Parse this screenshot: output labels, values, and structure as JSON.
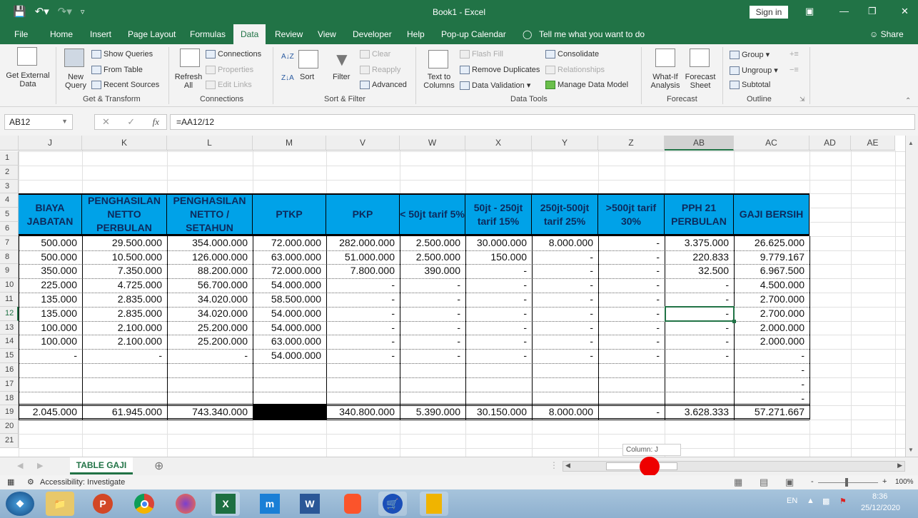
{
  "app": {
    "title": "Book1  -  Excel",
    "sign_in": "Sign in",
    "share": "Share"
  },
  "menu": {
    "tabs": [
      "File",
      "Home",
      "Insert",
      "Page Layout",
      "Formulas",
      "Data",
      "Review",
      "View",
      "Developer",
      "Help",
      "Pop-up Calendar"
    ],
    "active_tab": "Data",
    "tell_me": "Tell me what you want to do"
  },
  "ribbon": {
    "get_external_data": "Get External Data",
    "new_query": "New Query",
    "show_queries": "Show Queries",
    "from_table": "From Table",
    "recent_sources": "Recent Sources",
    "get_transform": "Get & Transform",
    "refresh_all": "Refresh All",
    "connections": "Connections",
    "properties": "Properties",
    "edit_links": "Edit Links",
    "connections_group": "Connections",
    "sort": "Sort",
    "filter": "Filter",
    "clear": "Clear",
    "reapply": "Reapply",
    "advanced": "Advanced",
    "sort_filter_group": "Sort & Filter",
    "text_to_columns": "Text to Columns",
    "flash_fill": "Flash Fill",
    "remove_duplicates": "Remove Duplicates",
    "data_validation": "Data Validation",
    "consolidate": "Consolidate",
    "relationships": "Relationships",
    "manage_data_model": "Manage Data Model",
    "data_tools_group": "Data Tools",
    "what_if": "What-If Analysis",
    "forecast_sheet": "Forecast Sheet",
    "forecast_group": "Forecast",
    "group": "Group",
    "ungroup": "Ungroup",
    "subtotal": "Subtotal",
    "outline_group": "Outline"
  },
  "formula_bar": {
    "name_box": "AB12",
    "formula": "=AA12/12",
    "fx": "fx"
  },
  "columns": [
    "J",
    "K",
    "L",
    "M",
    "V",
    "W",
    "X",
    "Y",
    "Z",
    "AB",
    "AC",
    "AD",
    "AE"
  ],
  "selected_column": "AB",
  "rows": [
    "1",
    "2",
    "3",
    "4",
    "5",
    "6",
    "7",
    "8",
    "9",
    "10",
    "11",
    "12",
    "13",
    "14",
    "15",
    "16",
    "17",
    "18",
    "19",
    "20",
    "21"
  ],
  "selected_row": "12",
  "table": {
    "headers": [
      "BIAYA JABATAN",
      "PENGHASILAN NETTO PERBULAN",
      "PENGHASILAN NETTO / SETAHUN",
      "PTKP",
      "PKP",
      "< 50jt tarif 5%",
      "50jt - 250jt tarif 15%",
      "250jt-500jt tarif 25%",
      ">500jt tarif 30%",
      "PPH 21 PERBULAN",
      "GAJI BERSIH"
    ],
    "header_color": "#00a2e8",
    "data": [
      [
        "500.000",
        "29.500.000",
        "354.000.000",
        "72.000.000",
        "282.000.000",
        "2.500.000",
        "30.000.000",
        "8.000.000",
        "-",
        "3.375.000",
        "26.625.000"
      ],
      [
        "500.000",
        "10.500.000",
        "126.000.000",
        "63.000.000",
        "51.000.000",
        "2.500.000",
        "150.000",
        "-",
        "-",
        "220.833",
        "9.779.167"
      ],
      [
        "350.000",
        "7.350.000",
        "88.200.000",
        "72.000.000",
        "7.800.000",
        "390.000",
        "-",
        "-",
        "-",
        "32.500",
        "6.967.500"
      ],
      [
        "225.000",
        "4.725.000",
        "56.700.000",
        "54.000.000",
        "-",
        "-",
        "-",
        "-",
        "-",
        "-",
        "4.500.000"
      ],
      [
        "135.000",
        "2.835.000",
        "34.020.000",
        "58.500.000",
        "-",
        "-",
        "-",
        "-",
        "-",
        "-",
        "2.700.000"
      ],
      [
        "135.000",
        "2.835.000",
        "34.020.000",
        "54.000.000",
        "-",
        "-",
        "-",
        "-",
        "-",
        "-",
        "2.700.000"
      ],
      [
        "100.000",
        "2.100.000",
        "25.200.000",
        "54.000.000",
        "-",
        "-",
        "-",
        "-",
        "-",
        "-",
        "2.000.000"
      ],
      [
        "100.000",
        "2.100.000",
        "25.200.000",
        "63.000.000",
        "-",
        "-",
        "-",
        "-",
        "-",
        "-",
        "2.000.000"
      ],
      [
        "-",
        "-",
        "-",
        "54.000.000",
        "-",
        "-",
        "-",
        "-",
        "-",
        "-",
        "-"
      ],
      [
        "",
        "",
        "",
        "",
        "",
        "",
        "",
        "",
        "",
        "",
        "-"
      ],
      [
        "",
        "",
        "",
        "",
        "",
        "",
        "",
        "",
        "",
        "",
        "-"
      ],
      [
        "",
        "",
        "",
        "",
        "",
        "",
        "",
        "",
        "",
        "",
        "-"
      ]
    ],
    "totals": [
      "2.045.000",
      "61.945.000",
      "743.340.000",
      "",
      "340.800.000",
      "5.390.000",
      "30.150.000",
      "8.000.000",
      "-",
      "3.628.333",
      "57.271.667"
    ]
  },
  "tooltip": "Column: J",
  "sheet": {
    "tab": "TABLE GAJI"
  },
  "status": {
    "accessibility": "Accessibility: Investigate",
    "zoom": "100%"
  },
  "taskbar": {
    "apps": [
      "start",
      "file-explorer",
      "powerpoint",
      "chrome",
      "firefox",
      "excel",
      "maxthon",
      "word",
      "brave",
      "store",
      "sticky"
    ],
    "lang": "EN",
    "time": "8:36",
    "date": "25/12/2020"
  }
}
